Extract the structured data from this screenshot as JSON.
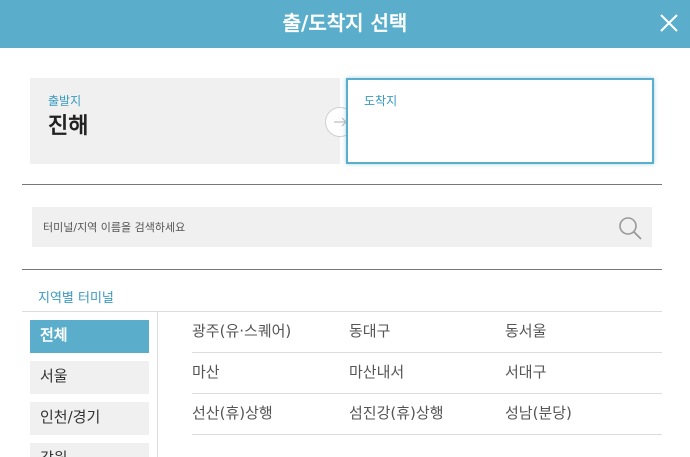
{
  "header": {
    "title": "출/도착지 선택"
  },
  "origin": {
    "label": "출발지",
    "value": "진해"
  },
  "destination": {
    "label": "도착지",
    "value": ""
  },
  "search": {
    "placeholder": "터미널/지역 이름을 검색하세요"
  },
  "section": {
    "title": "지역별 터미널"
  },
  "regions": [
    "전체",
    "서울",
    "인천/경기",
    "강원"
  ],
  "active_region": "전체",
  "terminals": [
    [
      "광주(유·스퀘어)",
      "동대구",
      "동서울"
    ],
    [
      "마산",
      "마산내서",
      "서대구"
    ],
    [
      "선산(휴)상행",
      "섬진강(휴)상행",
      "성남(분당)"
    ]
  ],
  "colors": {
    "accent": "#5aaecb",
    "accent_text": "#3a9ac0",
    "panel": "#f0f0f0"
  }
}
